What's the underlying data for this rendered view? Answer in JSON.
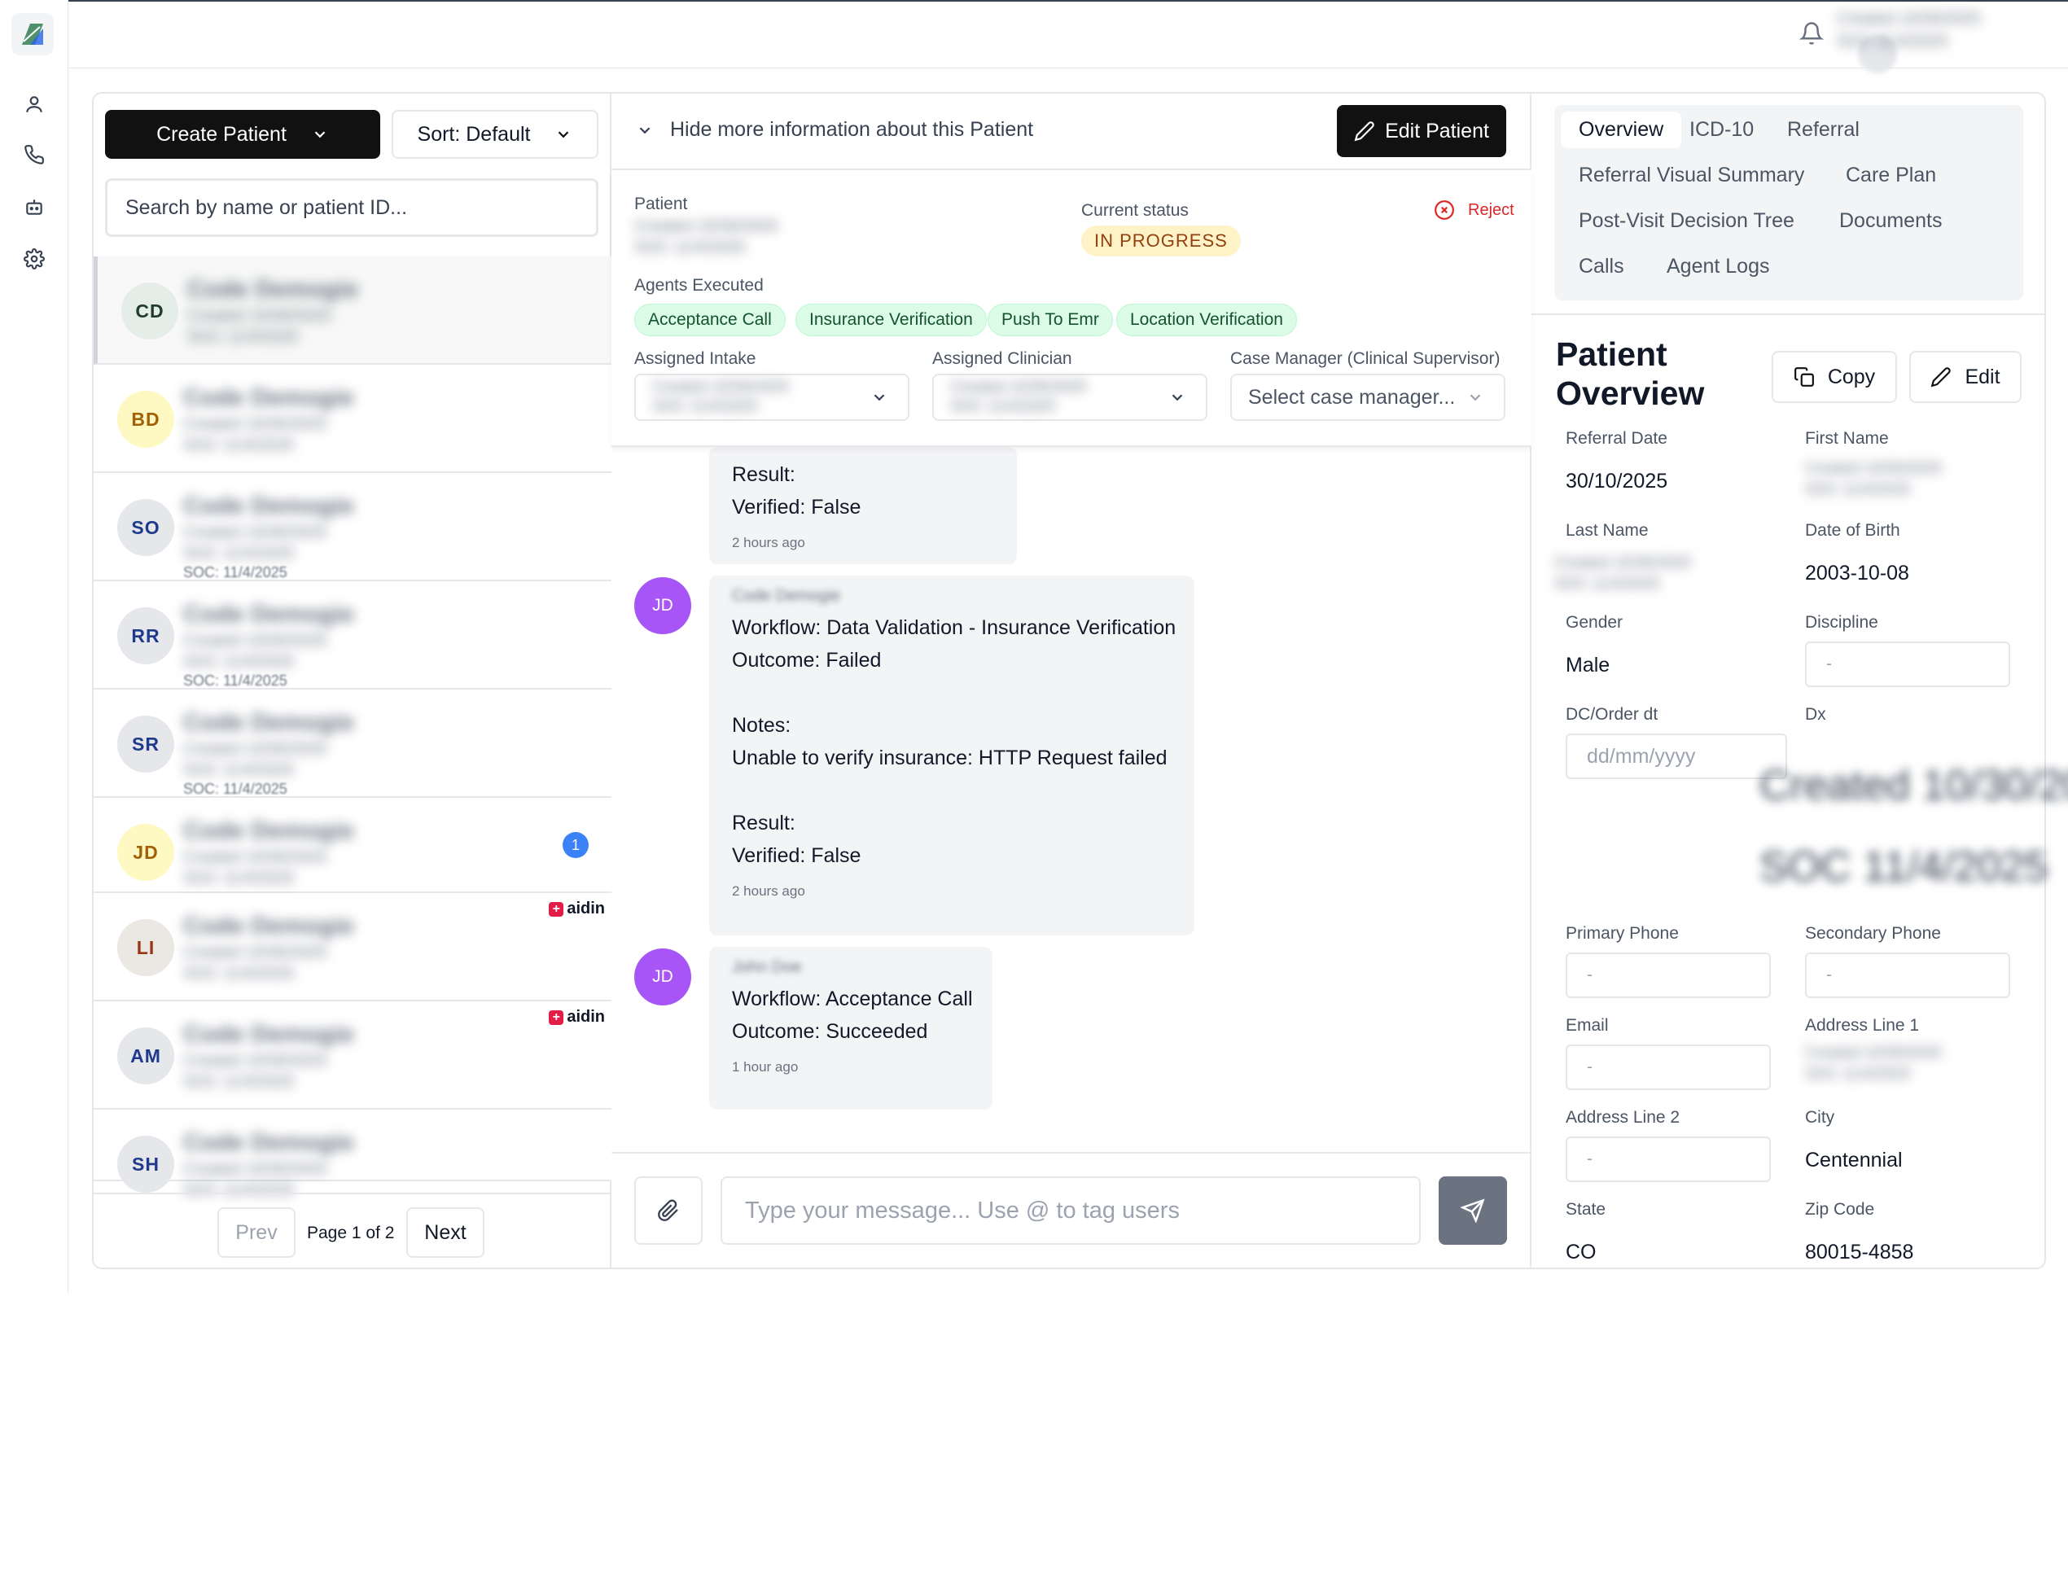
{
  "rail": {
    "icons": [
      "logo-icon",
      "user-icon",
      "phone-icon",
      "bot-icon",
      "gear-icon"
    ]
  },
  "topbar": {
    "user_line1": "Created 10/30/2025",
    "user_line2": "SOC 11/4/2025"
  },
  "list": {
    "create_label": "Create Patient",
    "sort_label": "Sort: Default",
    "search_placeholder": "Search by name or patient ID...",
    "placeholder_name": "Code Demogie",
    "placeholder_line1": "Created 10/30/2025",
    "placeholder_line2": "SOC 11/4/2025",
    "rows": [
      {
        "initials": "CD",
        "bg": "#e5ede8",
        "fg": "#1f3b2f",
        "soc": "",
        "badge": "",
        "aidin": ""
      },
      {
        "initials": "BD",
        "bg": "#fef9c3",
        "fg": "#a16207",
        "soc": "",
        "badge": "",
        "aidin": ""
      },
      {
        "initials": "SO",
        "bg": "#e5e7eb",
        "fg": "#1e3a8a",
        "soc": "SOC: 11/4/2025",
        "badge": "",
        "aidin": ""
      },
      {
        "initials": "RR",
        "bg": "#e5e7eb",
        "fg": "#1e3a8a",
        "soc": "SOC: 11/4/2025",
        "badge": "",
        "aidin": ""
      },
      {
        "initials": "SR",
        "bg": "#e5e7eb",
        "fg": "#1e3a8a",
        "soc": "SOC: 11/4/2025",
        "badge": "",
        "aidin": ""
      },
      {
        "initials": "JD",
        "bg": "#fef9c3",
        "fg": "#a16207",
        "soc": "",
        "badge": "1",
        "aidin": ""
      },
      {
        "initials": "LI",
        "bg": "#ebe8e3",
        "fg": "#9a3412",
        "soc": "",
        "badge": "",
        "aidin": "aidin"
      },
      {
        "initials": "AM",
        "bg": "#e5e7eb",
        "fg": "#1e3a8a",
        "soc": "",
        "badge": "",
        "aidin": "aidin"
      },
      {
        "initials": "SH",
        "bg": "#e5e7eb",
        "fg": "#1e3a8a",
        "soc": "",
        "badge": "",
        "aidin": ""
      }
    ],
    "prev_label": "Prev",
    "page_info": "Page 1 of 2",
    "next_label": "Next"
  },
  "chat": {
    "hide_info_label": "Hide more information about this Patient",
    "edit_patient_label": "Edit Patient",
    "patient_label": "Patient",
    "patient_line1": "Created 10/30/2025",
    "patient_line2": "SOC 11/4/2025",
    "current_status_label": "Current status",
    "status_value": "IN PROGRESS",
    "reject_label": "Reject",
    "agents_label": "Agents Executed",
    "agents": [
      "Acceptance Call",
      "Insurance Verification",
      "Push To Emr",
      "Location Verification"
    ],
    "assigned_intake_label": "Assigned Intake",
    "assigned_clinician_label": "Assigned Clinician",
    "case_manager_label": "Case Manager (Clinical Supervisor)",
    "case_manager_placeholder": "Select case manager...",
    "messages": [
      {
        "initials": "",
        "author": "",
        "lines": [
          "Result:",
          "Verified: False"
        ],
        "time": "2 hours ago"
      },
      {
        "initials": "JD",
        "author": "Code Demogie",
        "lines": [
          "Workflow: Data Validation - Insurance Verification",
          "Outcome: Failed",
          "",
          "Notes:",
          "Unable to verify insurance: HTTP Request failed",
          "",
          "Result:",
          "Verified: False"
        ],
        "time": "2 hours ago"
      },
      {
        "initials": "JD",
        "author": "John Doe",
        "lines": [
          "Workflow: Acceptance Call",
          "Outcome: Succeeded"
        ],
        "time": "1 hour ago"
      }
    ],
    "composer_placeholder": "Type your message... Use @ to tag users"
  },
  "overview": {
    "tabs": [
      "Overview",
      "ICD-10",
      "Referral",
      "Referral Visual Summary",
      "Care Plan",
      "Post-Visit Decision Tree",
      "Documents",
      "Calls",
      "Agent Logs"
    ],
    "title_line1": "Patient",
    "title_line2": "Overview",
    "copy_label": "Copy",
    "edit_label": "Edit",
    "fields": {
      "referral_date_label": "Referral Date",
      "referral_date_value": "30/10/2025",
      "first_name_label": "First Name",
      "first_name_blur1": "Created 10/30/2025",
      "first_name_blur2": "SOC 11/4/2025",
      "last_name_label": "Last Name",
      "dob_label": "Date of Birth",
      "dob_value": "2003-10-08",
      "gender_label": "Gender",
      "gender_value": "Male",
      "discipline_label": "Discipline",
      "discipline_value": "-",
      "dc_order_label": "DC/Order dt",
      "dc_order_placeholder": "dd/mm/yyyy",
      "dx_label": "Dx",
      "dx_blur1": "Created 10/30/2025",
      "dx_blur2": "SOC 11/4/2025",
      "primary_phone_label": "Primary Phone",
      "primary_phone_value": "-",
      "secondary_phone_label": "Secondary Phone",
      "secondary_phone_value": "-",
      "email_label": "Email",
      "email_value": "-",
      "address1_label": "Address Line 1",
      "address2_label": "Address Line 2",
      "address2_value": "-",
      "city_label": "City",
      "city_value": "Centennial",
      "state_label": "State",
      "state_value": "CO",
      "zip_label": "Zip Code",
      "zip_value": "80015-4858"
    }
  },
  "colors": {
    "accent_dark": "#111111",
    "status_bg": "#fef3c7",
    "status_fg": "#92400e",
    "agent_chip_bg": "#dcfce7",
    "reject": "#dc2626",
    "message_avatar": "#a855f7",
    "badge": "#3b82f6"
  }
}
